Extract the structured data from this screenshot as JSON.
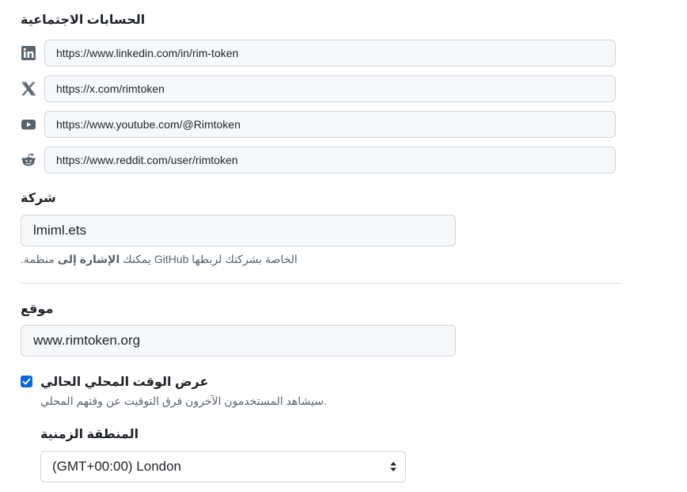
{
  "social": {
    "heading": "الحسابات الاجتماعية",
    "links": [
      {
        "icon": "linkedin-icon",
        "url": "https://www.linkedin.com/in/rim-token"
      },
      {
        "icon": "x-icon",
        "url": "https://x.com/rimtoken"
      },
      {
        "icon": "youtube-icon",
        "url": "https://www.youtube.com/@Rimtoken"
      },
      {
        "icon": "reddit-icon",
        "url": "https://www.reddit.com/user/rimtoken"
      }
    ]
  },
  "company": {
    "label": "شركة",
    "value": "lmiml.ets",
    "note_prefix": "الخاصة بشركتك لربطها GitHub يمكنك ",
    "note_bold": "الإشارة إلى",
    "note_suffix": " منظمة."
  },
  "location": {
    "label": "موقع",
    "value": "www.rimtoken.org"
  },
  "local_time": {
    "checked": true,
    "label": "عرض الوقت المحلي الحالي",
    "note": "سيشاهد المستخدمون الآخرون فرق التوقيت عن وقتهم المحلي."
  },
  "timezone": {
    "label": "المنطقة الزمنية",
    "selected": "(GMT+00:00) London"
  },
  "colors": {
    "accent": "#0969da",
    "input_bg": "#f6f8fa",
    "border": "#d0d7de",
    "muted_text": "#59636e"
  }
}
